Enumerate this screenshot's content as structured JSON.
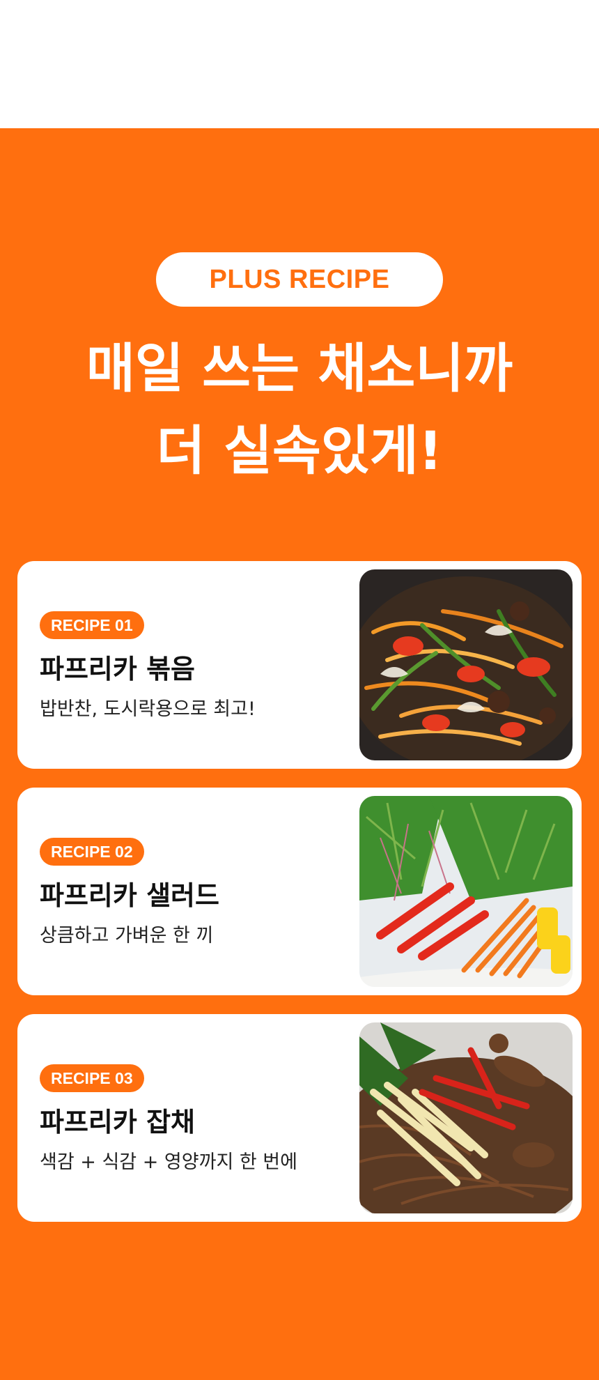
{
  "header": {
    "label": "PLUS RECIPE",
    "headline_line1": "매일 쓰는 채소니까",
    "headline_line2": "더 실속있게!"
  },
  "recipes": [
    {
      "badge": "RECIPE 01",
      "title": "파프리카 볶음",
      "description": "밥반찬, 도시락용으로 최고!",
      "image": "stir-fried-paprika-photo"
    },
    {
      "badge": "RECIPE 02",
      "title": "파프리카 샐러드",
      "description": "상큼하고 가벼운 한 끼",
      "image": "paprika-salad-photo"
    },
    {
      "badge": "RECIPE 03",
      "title": "파프리카 잡채",
      "description": "색감 + 식감 + 영양까지 한 번에",
      "image": "paprika-japchae-photo"
    }
  ],
  "colors": {
    "accent": "#ff6f0f",
    "card": "#ffffff",
    "text": "#111111"
  }
}
